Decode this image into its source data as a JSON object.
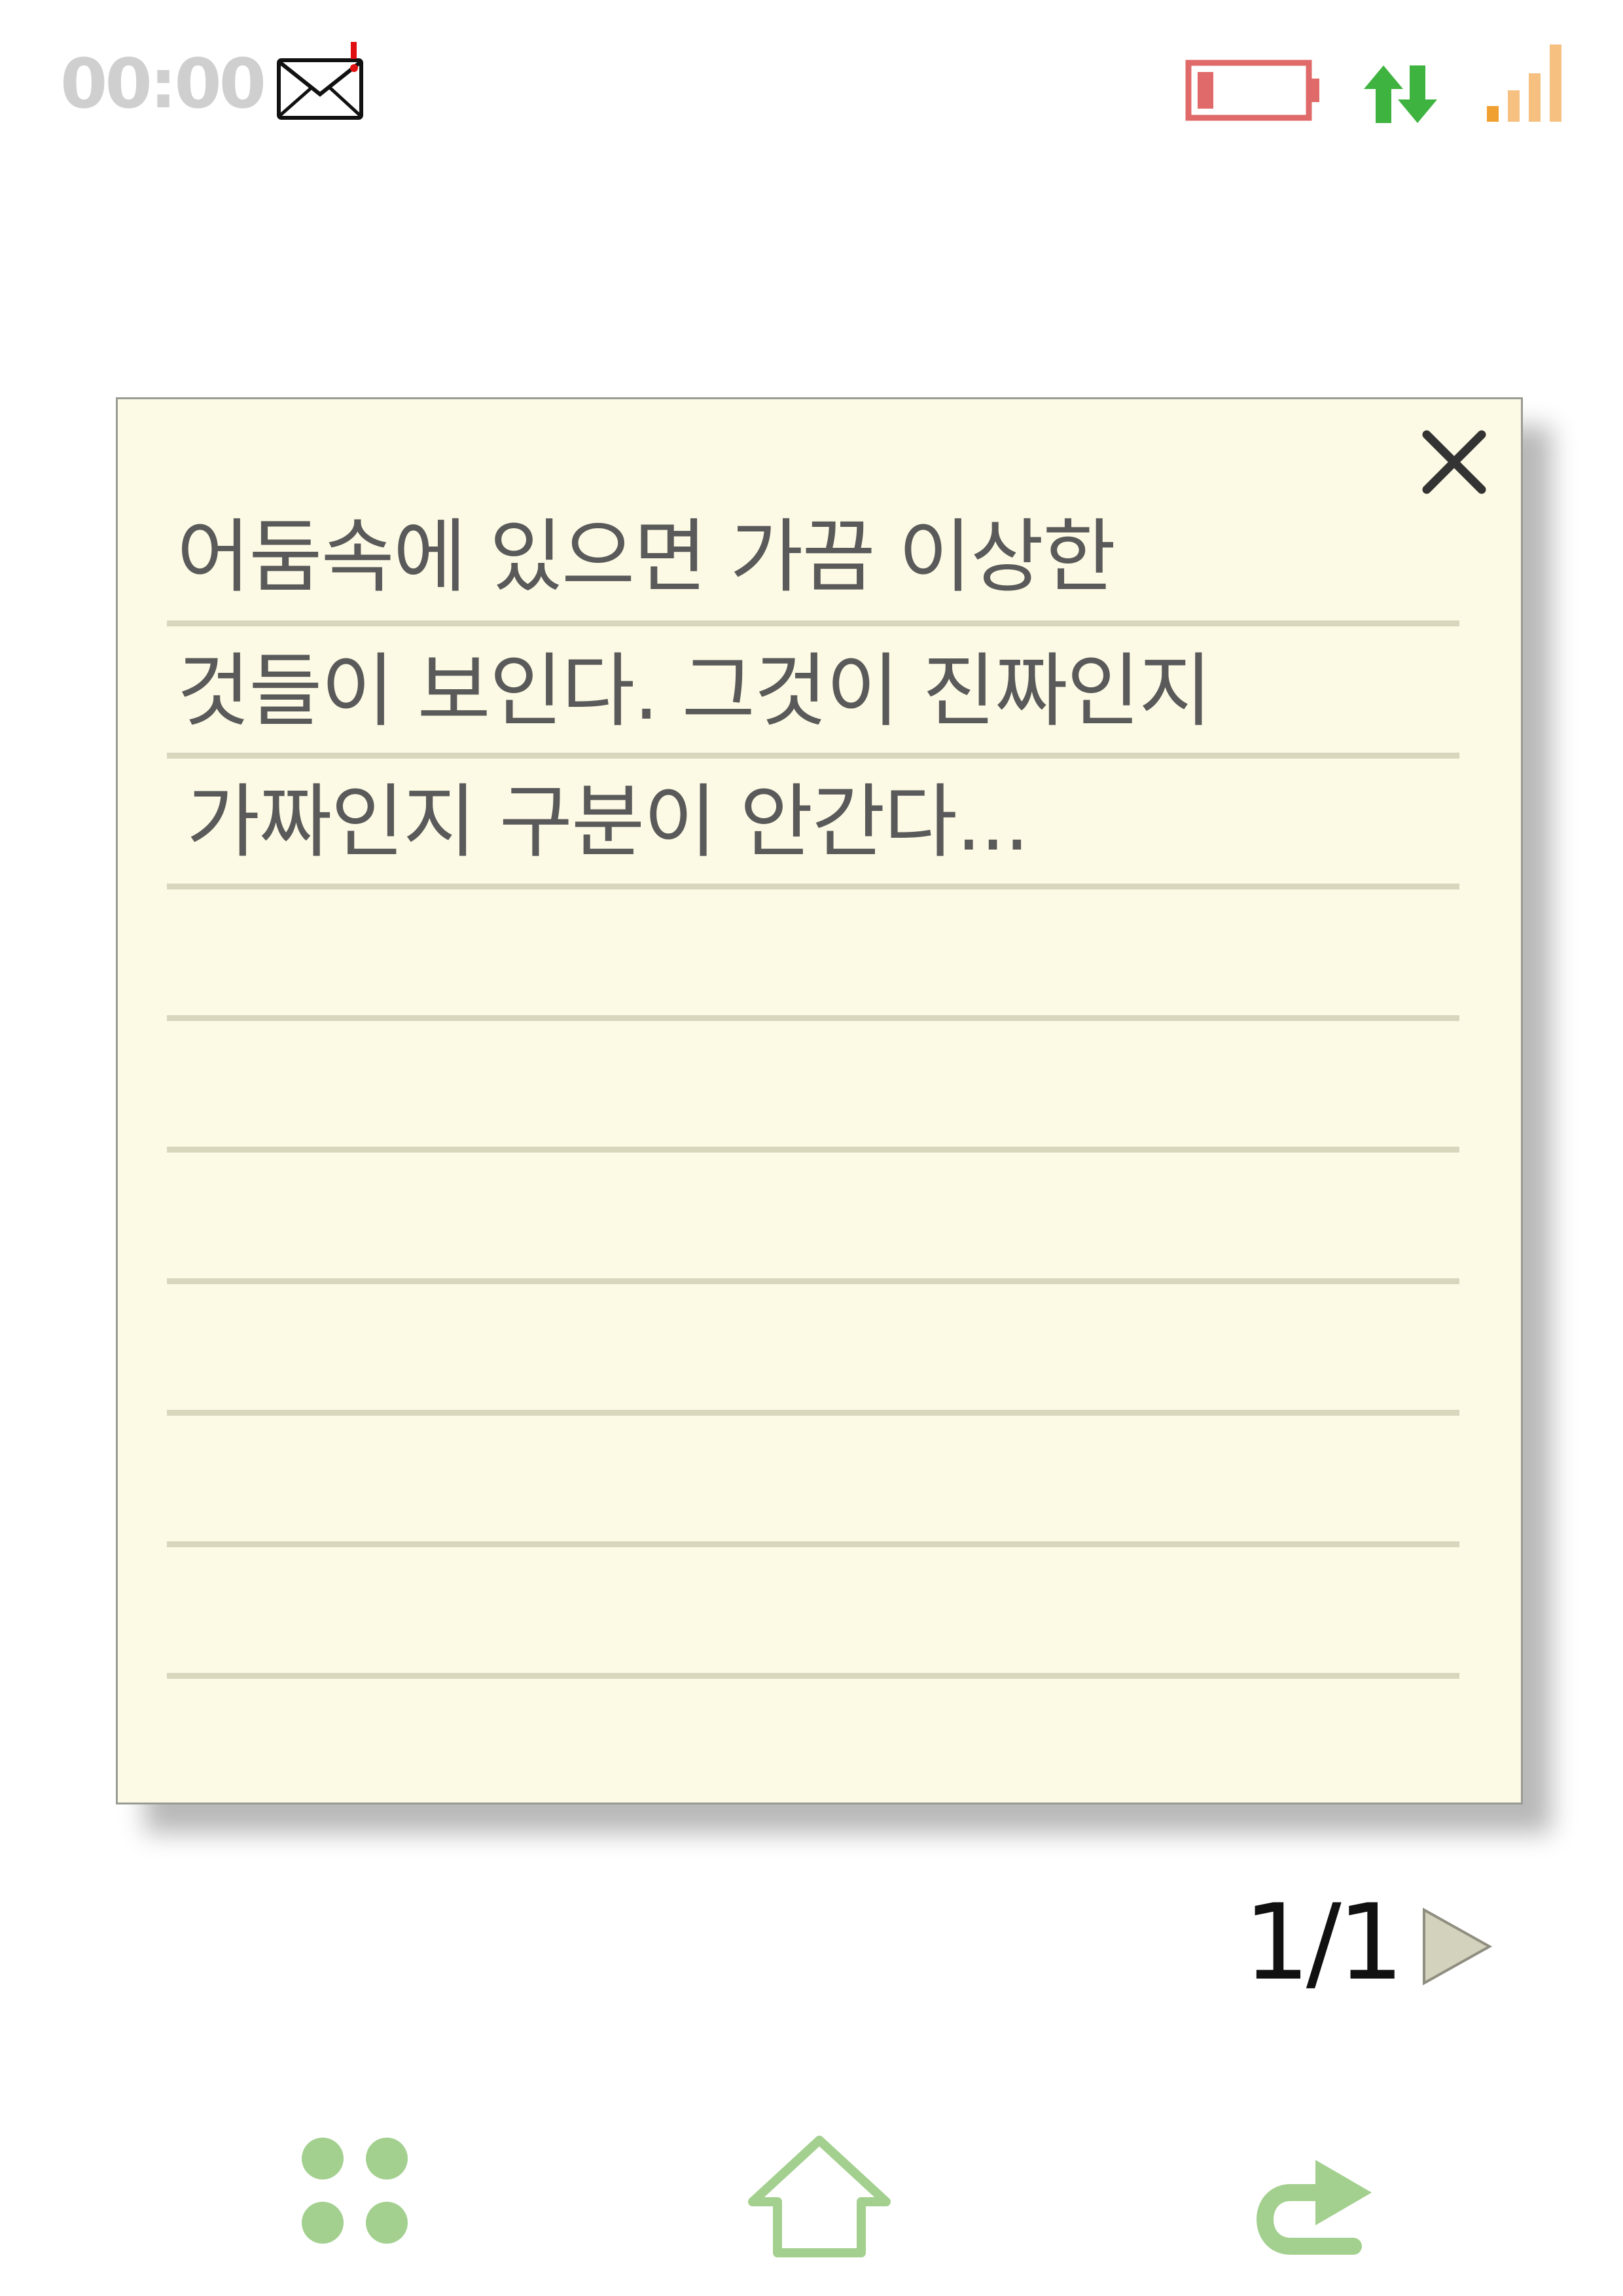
{
  "status_bar": {
    "time": "00:00",
    "icons": [
      "mail-alert-icon",
      "battery-low-icon",
      "data-transfer-icon",
      "signal-icon"
    ],
    "colors": {
      "clock": "#cfcfcf",
      "battery": "#e06a6a",
      "data_arrows": "#3fb33f",
      "signal": "#f0a030"
    }
  },
  "memo": {
    "lines": [
      "어둠속에 있으면 가끔 이상한",
      "것들이 보인다. 그것이 진짜인지",
      "가짜인지 구분이 안간다..."
    ],
    "close_icon": "close-icon",
    "background": "#fcfae4"
  },
  "pager": {
    "page_label": "1/1",
    "next_icon": "play-triangle-icon"
  },
  "bottom_nav": {
    "items": [
      "apps-icon",
      "home-icon",
      "back-icon"
    ],
    "color": "#a3d08f"
  }
}
